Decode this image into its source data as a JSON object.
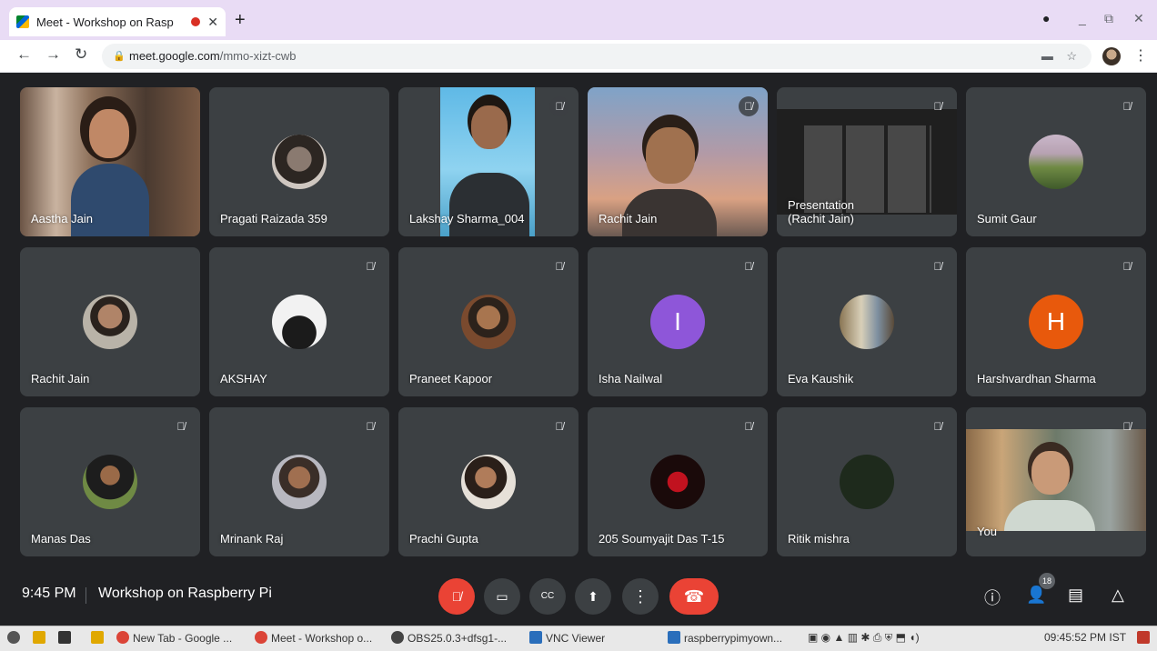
{
  "browser": {
    "tab_title": "Meet - Workshop on Rasp",
    "tab_close": "✕",
    "new_tab": "+",
    "url_host": "meet.google.com",
    "url_path": "/mmo-xizt-cwb"
  },
  "participants": [
    {
      "name": "Aastha Jain",
      "muted": false,
      "kind": "video"
    },
    {
      "name": "Pragati Raizada 359",
      "muted": false,
      "kind": "avatar"
    },
    {
      "name": "Lakshay Sharma_004",
      "muted": true,
      "kind": "video"
    },
    {
      "name": "Rachit Jain",
      "muted": true,
      "kind": "video"
    },
    {
      "name": "Presentation\n(Rachit Jain)",
      "muted": true,
      "kind": "presentation"
    },
    {
      "name": "Sumit Gaur",
      "muted": true,
      "kind": "avatar"
    },
    {
      "name": "Rachit Jain",
      "muted": false,
      "kind": "avatar"
    },
    {
      "name": "AKSHAY",
      "muted": true,
      "kind": "avatar"
    },
    {
      "name": "Praneet Kapoor",
      "muted": true,
      "kind": "avatar"
    },
    {
      "name": "Isha Nailwal",
      "muted": true,
      "kind": "letter",
      "letter": "I",
      "color": "#8e56d9"
    },
    {
      "name": "Eva Kaushik",
      "muted": true,
      "kind": "avatar"
    },
    {
      "name": "Harshvardhan Sharma",
      "muted": true,
      "kind": "letter",
      "letter": "H",
      "color": "#e8590c"
    },
    {
      "name": "Manas Das",
      "muted": true,
      "kind": "avatar"
    },
    {
      "name": "Mrinank Raj",
      "muted": true,
      "kind": "avatar"
    },
    {
      "name": "Prachi Gupta",
      "muted": true,
      "kind": "avatar"
    },
    {
      "name": "205 Soumyajit Das T-15",
      "muted": true,
      "kind": "avatar"
    },
    {
      "name": "Ritik mishra",
      "muted": true,
      "kind": "avatar"
    },
    {
      "name": "You",
      "muted": true,
      "kind": "video"
    }
  ],
  "meeting": {
    "time": "9:45 PM",
    "title": "Workshop on Raspberry Pi",
    "people_count": "18"
  },
  "taskbar": {
    "items": [
      "New Tab - Google ...",
      "Meet - Workshop o...",
      "OBS25.0.3+dfsg1-...",
      "VNC Viewer",
      "raspberrypimyown..."
    ],
    "clock": "09:45:52 PM IST"
  },
  "colors": {
    "accent_red": "#ea4335",
    "tile_bg": "#3c4043",
    "page_bg": "#202124"
  }
}
